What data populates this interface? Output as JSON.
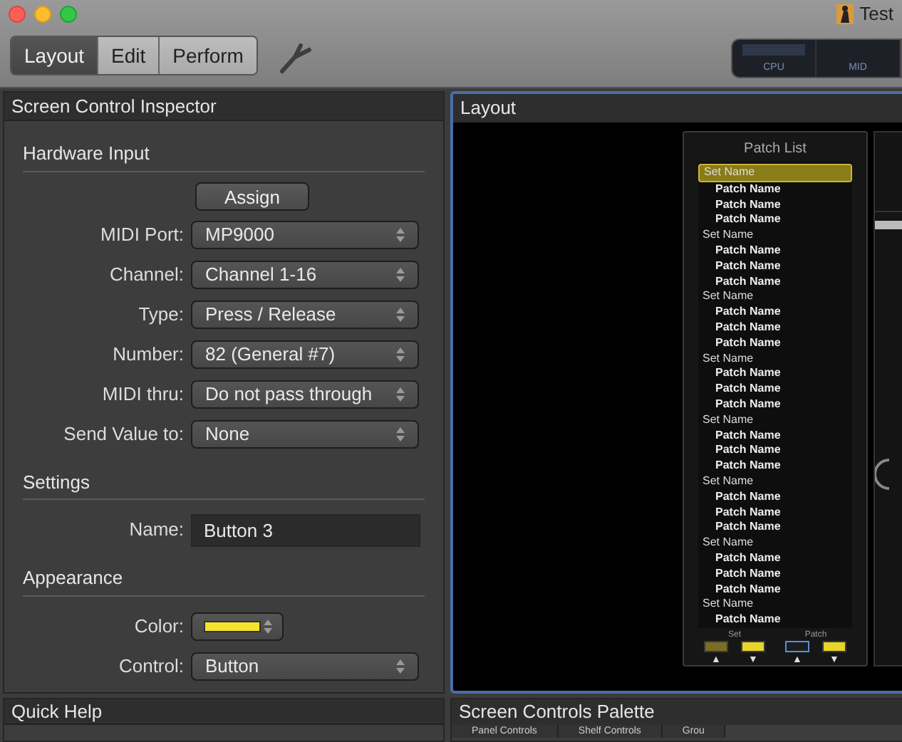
{
  "window": {
    "title": "Test"
  },
  "modes": [
    {
      "label": "Layout",
      "selected": true
    },
    {
      "label": "Edit",
      "selected": false
    },
    {
      "label": "Perform",
      "selected": false
    }
  ],
  "meters": [
    {
      "label": "CPU"
    },
    {
      "label": "MID"
    }
  ],
  "inspector": {
    "title": "Screen Control Inspector",
    "sections": [
      {
        "title": "Hardware Input",
        "button": "Assign",
        "fields": [
          {
            "kind": "popup",
            "label": "MIDI Port:",
            "value": "MP9000"
          },
          {
            "kind": "popup",
            "label": "Channel:",
            "value": "Channel 1-16"
          },
          {
            "kind": "popup",
            "label": "Type:",
            "value": "Press / Release"
          },
          {
            "kind": "popup",
            "label": "Number:",
            "value": "82 (General #7)"
          },
          {
            "kind": "popup",
            "label": "MIDI thru:",
            "value": "Do not pass through"
          },
          {
            "kind": "popup",
            "label": "Send Value to:",
            "value": "None"
          }
        ]
      },
      {
        "title": "Settings",
        "fields": [
          {
            "kind": "text",
            "label": "Name:",
            "value": "Button 3"
          }
        ]
      },
      {
        "title": "Appearance",
        "fields": [
          {
            "kind": "color",
            "label": "Color:",
            "color": "#f4e42c"
          },
          {
            "kind": "popup",
            "label": "Control:",
            "value": "Button"
          }
        ]
      }
    ]
  },
  "layout": {
    "title": "Layout",
    "patch_list": {
      "title": "Patch List",
      "sets": [
        {
          "name": "Set Name",
          "selected": true,
          "children": [
            {
              "name": "Patch Name"
            },
            {
              "name": "Patch Name"
            },
            {
              "name": "Patch Name"
            }
          ]
        },
        {
          "name": "Set Name",
          "selected": false,
          "children": [
            {
              "name": "Patch Name"
            },
            {
              "name": "Patch Name"
            },
            {
              "name": "Patch Name"
            }
          ]
        },
        {
          "name": "Set Name",
          "selected": false,
          "children": [
            {
              "name": "Patch Name"
            },
            {
              "name": "Patch Name"
            },
            {
              "name": "Patch Name"
            }
          ]
        },
        {
          "name": "Set Name",
          "selected": false,
          "children": [
            {
              "name": "Patch Name"
            },
            {
              "name": "Patch Name"
            },
            {
              "name": "Patch Name"
            }
          ]
        },
        {
          "name": "Set Name",
          "selected": false,
          "children": [
            {
              "name": "Patch Name"
            },
            {
              "name": "Patch Name"
            },
            {
              "name": "Patch Name"
            }
          ]
        },
        {
          "name": "Set Name",
          "selected": false,
          "children": [
            {
              "name": "Patch Name"
            },
            {
              "name": "Patch Name"
            },
            {
              "name": "Patch Name"
            }
          ]
        },
        {
          "name": "Set Name",
          "selected": false,
          "children": [
            {
              "name": "Patch Name"
            },
            {
              "name": "Patch Name"
            },
            {
              "name": "Patch Name"
            }
          ]
        },
        {
          "name": "Set Name",
          "selected": false,
          "children": [
            {
              "name": "Patch Name"
            }
          ]
        }
      ],
      "groups": [
        {
          "label": "Set",
          "buttons": [
            {
              "lit": false,
              "selected": false,
              "arrow": "▲"
            },
            {
              "lit": true,
              "selected": false,
              "arrow": "▼"
            }
          ]
        },
        {
          "label": "Patch",
          "buttons": [
            {
              "lit": false,
              "selected": true,
              "arrow": "▲"
            },
            {
              "lit": true,
              "selected": false,
              "arrow": "▼"
            }
          ]
        }
      ]
    }
  },
  "quick_help": {
    "title": "Quick Help"
  },
  "palette": {
    "title": "Screen Controls Palette",
    "tabs": [
      {
        "label": "Panel Controls"
      },
      {
        "label": "Shelf Controls"
      },
      {
        "label": "Grou"
      }
    ]
  }
}
